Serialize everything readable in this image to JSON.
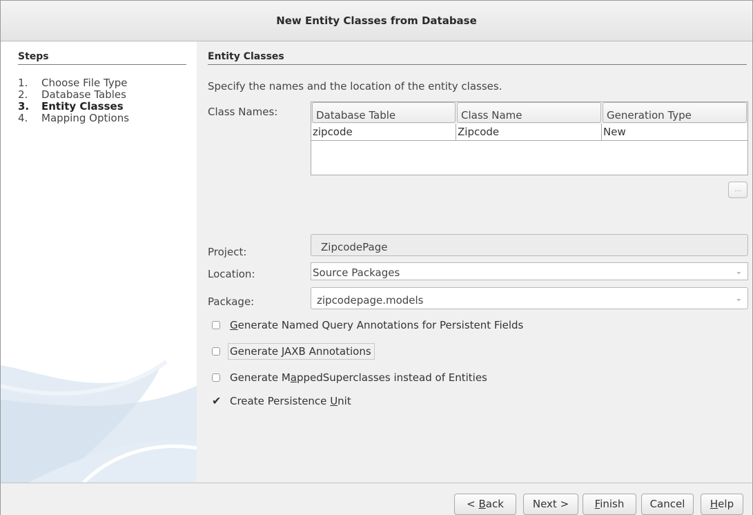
{
  "window": {
    "title": "New Entity Classes from Database"
  },
  "steps": {
    "header": "Steps",
    "items": [
      {
        "num": "1.",
        "label": "Choose File Type"
      },
      {
        "num": "2.",
        "label": "Database Tables"
      },
      {
        "num": "3.",
        "label": "Entity Classes"
      },
      {
        "num": "4.",
        "label": "Mapping Options"
      }
    ]
  },
  "panel": {
    "header": "Entity Classes",
    "description": "Specify the names and the location of the entity classes."
  },
  "class_names": {
    "label": "Class Names:",
    "columns": [
      "Database Table",
      "Class Name",
      "Generation Type"
    ],
    "rows": [
      [
        "zipcode",
        "Zipcode",
        "New"
      ]
    ],
    "more_button": "..."
  },
  "project": {
    "label": "Project:",
    "value": "ZipcodePage"
  },
  "location": {
    "label": "Location:",
    "value": "Source Packages"
  },
  "package": {
    "label": "Package:",
    "value": "zipcodepage.models"
  },
  "options": [
    {
      "pre": "",
      "key": "G",
      "post": "enerate Named Query Annotations for Persistent Fields",
      "checked": false
    },
    {
      "pre": "Generate ",
      "key": "J",
      "post": "AXB Annotations",
      "checked": false
    },
    {
      "pre": "Generate M",
      "key": "a",
      "post": "ppedSuperclasses instead of Entities",
      "checked": false
    },
    {
      "pre": "Create Persistence ",
      "key": "U",
      "post": "nit",
      "checked": true
    }
  ],
  "buttons": {
    "back": {
      "pre": "< ",
      "key": "B",
      "post": "ack"
    },
    "next": {
      "label": "Next >"
    },
    "finish": {
      "pre": "",
      "key": "F",
      "post": "inish"
    },
    "cancel": {
      "label": "Cancel"
    },
    "help": {
      "pre": "",
      "key": "H",
      "post": "elp"
    }
  },
  "icons": {
    "combo_arrow": "chevron-down-icon",
    "checked": "check-icon"
  }
}
